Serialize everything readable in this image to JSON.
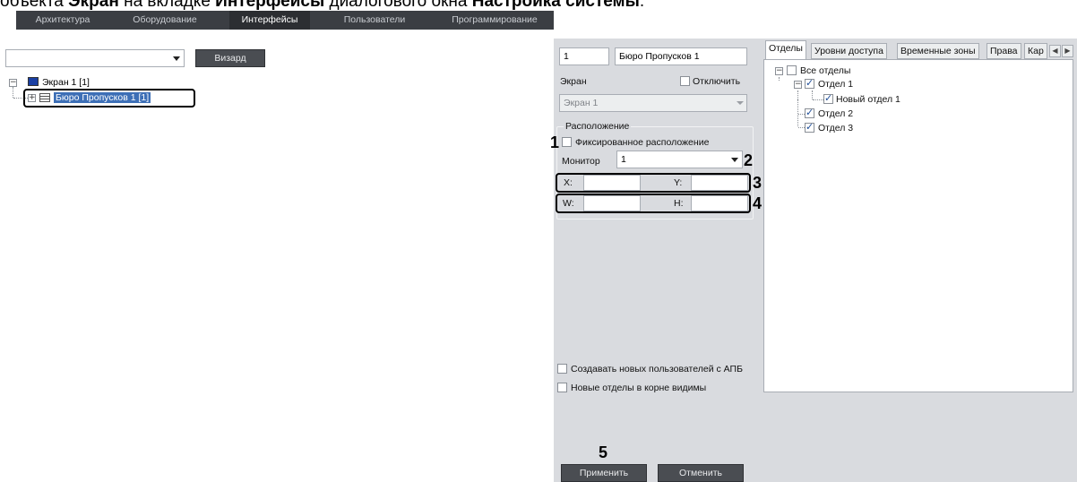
{
  "caption": {
    "prefix": "объекта ",
    "bold1": "Экран",
    "mid1": " на вкладке ",
    "bold2": "Интерфейсы",
    "mid2": " диалогового окна ",
    "bold3": "Настройка системы",
    "suffix": "."
  },
  "topbar": {
    "tabs": [
      {
        "label": "Архитектура"
      },
      {
        "label": "Оборудование"
      },
      {
        "label": "Интерфейсы"
      },
      {
        "label": "Пользователи"
      },
      {
        "label": "Программирование"
      }
    ],
    "active_tab": "Интерфейсы"
  },
  "left": {
    "combo_value": "",
    "wizard_label": "Визард",
    "tree": {
      "root": "Экран 1 [1]",
      "child": "Бюро Пропусков 1 [1]"
    }
  },
  "object": {
    "id": "1",
    "name": "Бюро Пропусков 1"
  },
  "screen": {
    "label": "Экран",
    "disable_label": "Отключить",
    "disabled_checked": false,
    "value": "Экран 1"
  },
  "location": {
    "group_label": "Расположение",
    "fixed_label": "Фиксированное расположение",
    "fixed_checked": false,
    "monitor_label": "Монитор",
    "monitor_value": "1",
    "x_label": "X:",
    "y_label": "Y:",
    "w_label": "W:",
    "h_label": "H:",
    "x_value": "",
    "y_value": "",
    "w_value": "",
    "h_value": ""
  },
  "options": {
    "create_users_label": "Создавать новых пользователей с АПБ",
    "create_users_checked": false,
    "new_depts_label": "Новые отделы в корне видимы",
    "new_depts_checked": false
  },
  "actions": {
    "apply_label": "Применить",
    "cancel_label": "Отменить"
  },
  "callouts": [
    "1",
    "2",
    "3",
    "4",
    "5"
  ],
  "right": {
    "tabs": [
      {
        "label": "Отделы"
      },
      {
        "label": "Уровни доступа"
      },
      {
        "label": "Временные зоны"
      },
      {
        "label": "Права"
      },
      {
        "label": "Кар"
      }
    ],
    "active_tab": "Отделы",
    "tree": {
      "root": {
        "label": "Все отделы",
        "checked": false
      },
      "items": [
        {
          "label": "Отдел 1",
          "checked": true
        },
        {
          "label": "Новый отдел 1",
          "checked": true
        },
        {
          "label": "Отдел 2",
          "checked": true
        },
        {
          "label": "Отдел 3",
          "checked": true
        }
      ]
    }
  },
  "colors": {
    "topbar_bg": "#3b3e43",
    "panel_bg": "#d9dbdf",
    "check_color": "#1f4e99",
    "screen_icon": "#1a3fa3"
  }
}
